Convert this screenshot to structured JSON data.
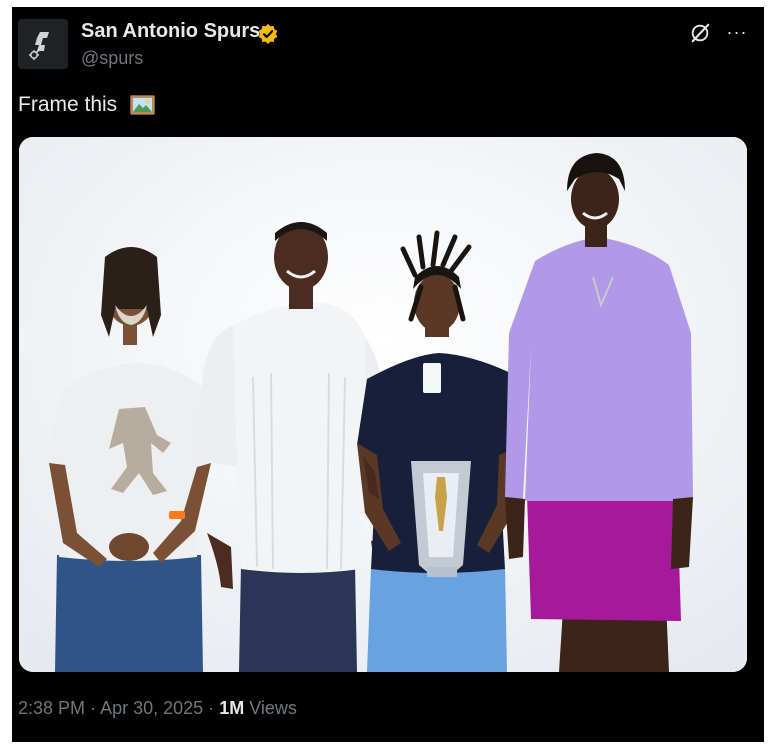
{
  "author": {
    "name": "San Antonio Spurs",
    "handle": "@spurs",
    "verified_badge_color": "#f5b90f",
    "avatar_icon": "spurs-logo-icon"
  },
  "actions": {
    "grok_icon": "grok-icon",
    "more_label": "···"
  },
  "tweet": {
    "text": "Frame this",
    "emoji": "framed-picture-emoji"
  },
  "media": {
    "kind": "photo",
    "subjects": [
      "person-white-tee",
      "person-white-shirt",
      "person-navy-polo-trophy",
      "person-lavender-shirt"
    ]
  },
  "meta": {
    "time": "2:38 PM",
    "separator": "·",
    "date": "Apr 30, 2025",
    "views_count": "1M",
    "views_label": "Views"
  },
  "colors": {
    "background": "#000000",
    "text_primary": "#e7e9ea",
    "text_secondary": "#71767b"
  }
}
